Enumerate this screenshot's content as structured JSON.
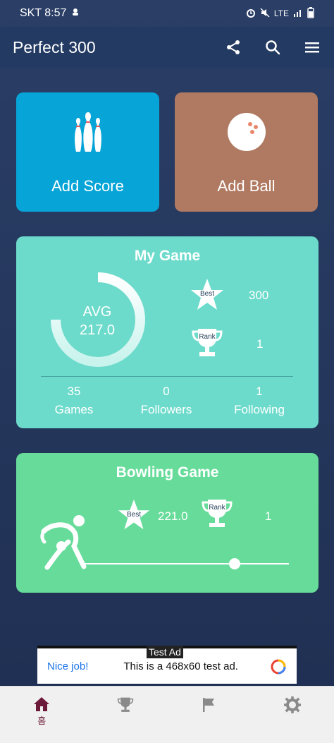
{
  "status": {
    "carrier_time": "SKT 8:57",
    "network": "LTE"
  },
  "appbar": {
    "title": "Perfect 300",
    "icons": [
      "share-icon",
      "search-icon",
      "menu-icon"
    ]
  },
  "actions": {
    "add_score_label": "Add Score",
    "add_ball_label": "Add Ball"
  },
  "my_game": {
    "title": "My Game",
    "avg_label": "AVG",
    "avg_value": "217.0",
    "best_badge": "Best",
    "best_value": "300",
    "rank_badge": "Rank",
    "rank_value": "1",
    "stats": [
      {
        "value": "35",
        "label": "Games"
      },
      {
        "value": "0",
        "label": "Followers"
      },
      {
        "value": "1",
        "label": "Following"
      }
    ]
  },
  "bowling_game": {
    "title": "Bowling Game",
    "best_badge": "Best",
    "best_value": "221.0",
    "rank_badge": "Rank",
    "rank_value": "1"
  },
  "ad": {
    "tag": "Test Ad",
    "nice": "Nice job!",
    "message": "This is a 468x60 test ad."
  },
  "bottom_nav": {
    "home_label": "홈",
    "items": [
      "home-icon",
      "trophy-icon",
      "flag-icon",
      "gear-icon"
    ]
  },
  "colors": {
    "add_score": "#07a4d7",
    "add_ball": "#b07a62",
    "my_game": "#6ddbcb",
    "bowling_game": "#67dc9a",
    "nav_active": "#6d1a3a"
  }
}
